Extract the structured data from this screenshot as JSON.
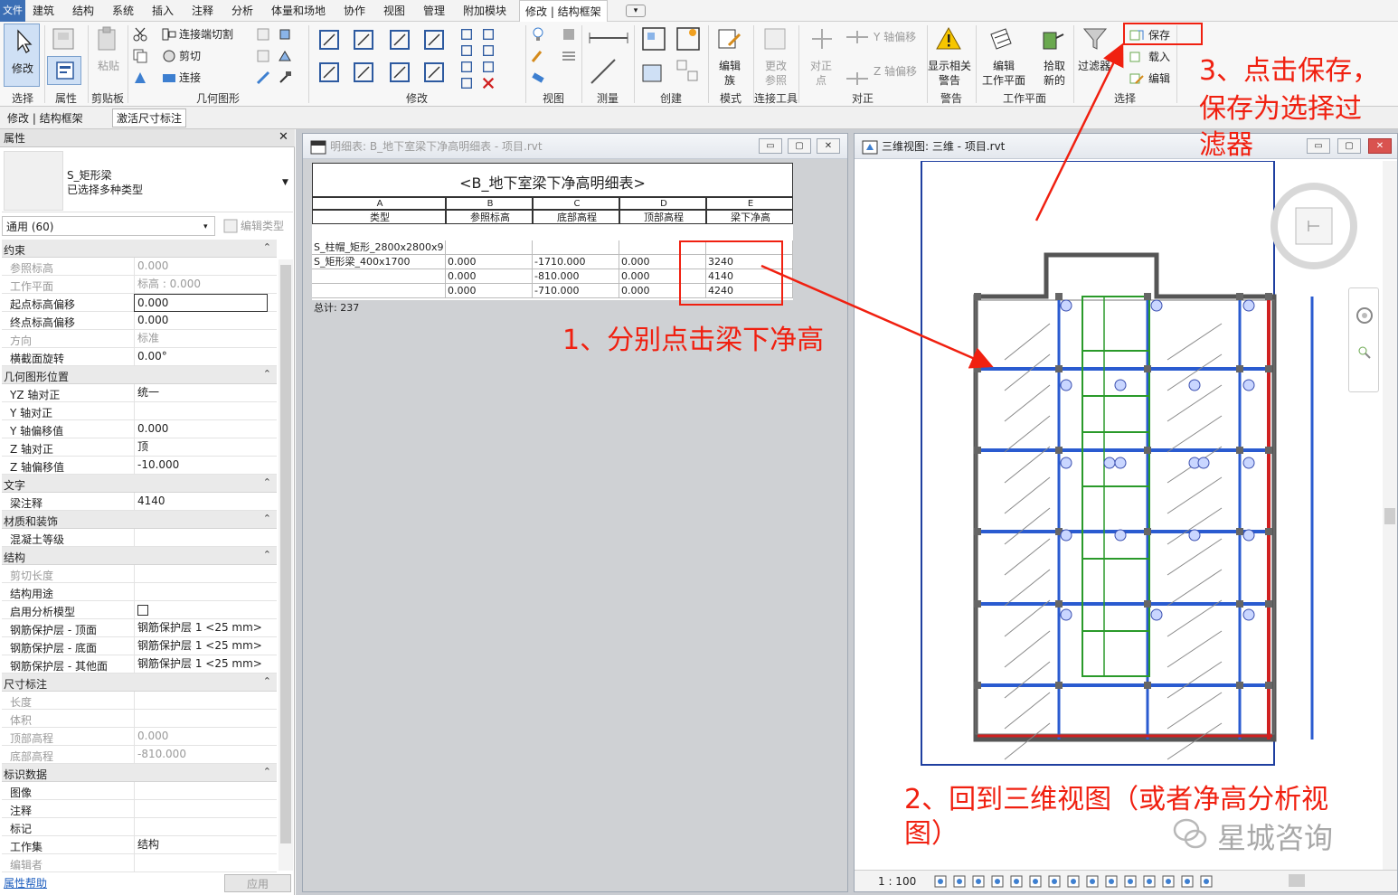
{
  "menubar": {
    "file": "文件",
    "items": [
      "建筑",
      "结构",
      "系统",
      "插入",
      "注释",
      "分析",
      "体量和场地",
      "协作",
      "视图",
      "管理",
      "附加模块"
    ],
    "active_tab": "修改 | 结构框架"
  },
  "ribbon": {
    "panels": [
      "选择",
      "属性",
      "剪贴板",
      "几何图形",
      "修改",
      "视图",
      "测量",
      "创建",
      "模式",
      "连接工具",
      "对正",
      "警告",
      "工作平面",
      "选择"
    ],
    "modify_label": "修改",
    "paste_label": "粘贴",
    "geom": {
      "cut_join": "连接端切割",
      "cut": "剪切",
      "join": "连接"
    },
    "edit_family": "编辑\n族",
    "edit_family_l1": "编辑",
    "edit_family_l2": "族",
    "change_ref_l1": "更改",
    "change_ref_l2": "参照",
    "align_point_l1": "对正",
    "align_point_l2": "点",
    "y_align": "Y 轴偏移",
    "z_align": "Z 轴偏移",
    "show_warn_l1": "显示相关",
    "show_warn_l2": "警告",
    "edit_wp_l1": "编辑",
    "edit_wp_l2": "工作平面",
    "pick_new_l1": "拾取",
    "pick_new_l2": "新的",
    "filter": "过滤器",
    "save": "保存",
    "load": "载入",
    "edit": "编辑"
  },
  "ctxbar": {
    "left": "修改 | 结构框架",
    "tab": "激活尺寸标注"
  },
  "props": {
    "title": "属性",
    "type_name": "S_矩形梁",
    "type_sub": "已选择多种类型",
    "filter": "通用 (60)",
    "edit_type": "编辑类型",
    "rows": [
      {
        "h": "约束"
      },
      {
        "k": "参照标高",
        "v": "0.000",
        "g": true
      },
      {
        "k": "工作平面",
        "v": "标高 : 0.000",
        "g": true
      },
      {
        "k": "起点标高偏移",
        "v": "0.000",
        "box": true
      },
      {
        "k": "终点标高偏移",
        "v": "0.000"
      },
      {
        "k": "方向",
        "v": "标准",
        "g": true
      },
      {
        "k": "横截面旋转",
        "v": "0.00°"
      },
      {
        "h": "几何图形位置"
      },
      {
        "k": "YZ 轴对正",
        "v": "统一"
      },
      {
        "k": "Y 轴对正",
        "v": ""
      },
      {
        "k": "Y 轴偏移值",
        "v": "0.000"
      },
      {
        "k": "Z 轴对正",
        "v": "顶"
      },
      {
        "k": "Z 轴偏移值",
        "v": "-10.000"
      },
      {
        "h": "文字"
      },
      {
        "k": "梁注释",
        "v": "4140"
      },
      {
        "h": "材质和装饰"
      },
      {
        "k": "混凝土等级",
        "v": ""
      },
      {
        "h": "结构"
      },
      {
        "k": "剪切长度",
        "v": "",
        "g": true
      },
      {
        "k": "结构用途",
        "v": ""
      },
      {
        "k": "启用分析模型",
        "v": "",
        "cb": true
      },
      {
        "k": "钢筋保护层 - 顶面",
        "v": "钢筋保护层 1 <25 mm>"
      },
      {
        "k": "钢筋保护层 - 底面",
        "v": "钢筋保护层 1 <25 mm>"
      },
      {
        "k": "钢筋保护层 - 其他面",
        "v": "钢筋保护层 1 <25 mm>"
      },
      {
        "h": "尺寸标注"
      },
      {
        "k": "长度",
        "v": "",
        "g": true
      },
      {
        "k": "体积",
        "v": "",
        "g": true
      },
      {
        "k": "顶部高程",
        "v": "0.000",
        "g": true
      },
      {
        "k": "底部高程",
        "v": "-810.000",
        "g": true
      },
      {
        "h": "标识数据"
      },
      {
        "k": "图像",
        "v": ""
      },
      {
        "k": "注释",
        "v": ""
      },
      {
        "k": "标记",
        "v": ""
      },
      {
        "k": "工作集",
        "v": "结构"
      },
      {
        "k": "编辑者",
        "v": "",
        "g": true
      }
    ],
    "help": "属性帮助",
    "apply": "应用"
  },
  "schedule_win": {
    "title": "明细表: B_地下室梁下净高明细表 - 项目.rvt",
    "heading": "<B_地下室梁下净高明细表>",
    "letters": [
      "A",
      "B",
      "C",
      "D",
      "E"
    ],
    "headers": [
      "类型",
      "参照标高",
      "底部高程",
      "顶部高程",
      "梁下净高"
    ],
    "rows": [
      [
        "S_柱帽_矩形_2800x2800x9",
        "",
        "",
        "",
        ""
      ],
      [
        "S_矩形梁_400x1700",
        "0.000",
        "-1710.000",
        "0.000",
        "3240"
      ],
      [
        "",
        "0.000",
        "-810.000",
        "0.000",
        "4140"
      ],
      [
        "",
        "0.000",
        "-710.000",
        "0.000",
        "4240"
      ]
    ],
    "total": "总计: 237"
  },
  "view3d_win": {
    "title": "三维视图: 三维 - 项目.rvt",
    "scale": "1 : 100"
  },
  "annotations": {
    "a1": "1、分别点击梁下净高",
    "a2_l1": "2、回到三维视图（或者净高分析视",
    "a2_l2": "图）",
    "a3_l1": "3、点击保存，",
    "a3_l2": "保存为选择过",
    "a3_l3": "滤器"
  },
  "watermark": "星城咨询"
}
